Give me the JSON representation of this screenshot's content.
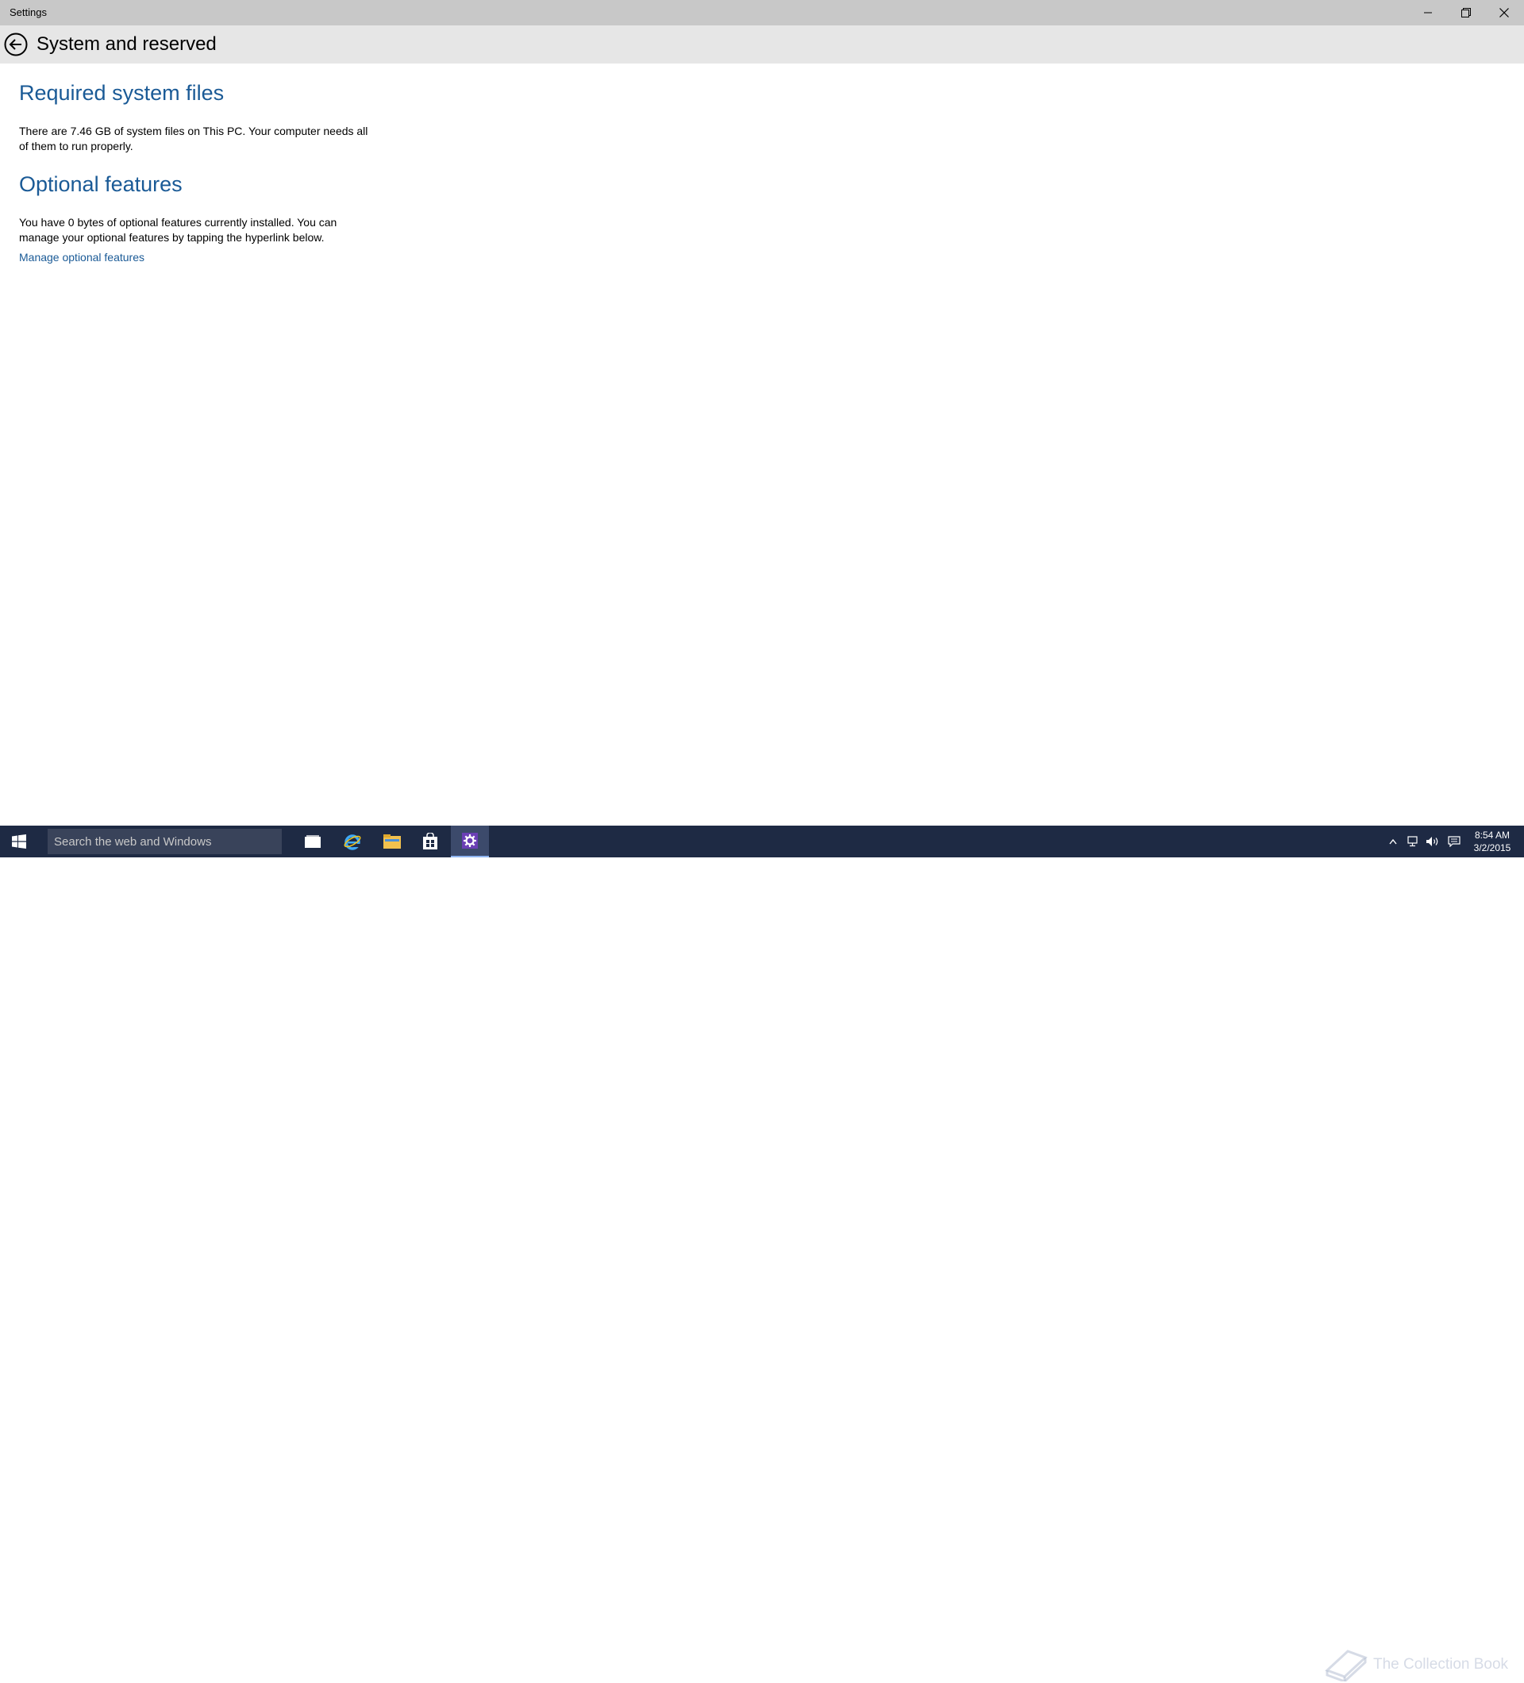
{
  "window": {
    "title": "Settings",
    "controls": [
      "minimize-icon",
      "restore-icon",
      "close-icon"
    ]
  },
  "header": {
    "back_icon": "back-arrow-icon",
    "page_title": "System and reserved"
  },
  "sections": {
    "required": {
      "title": "Required system files",
      "text": "There are 7.46 GB of system files on This PC. Your computer needs all of them to run properly."
    },
    "optional": {
      "title": "Optional features",
      "text": "You have 0 bytes of optional features currently installed. You can manage your optional features by tapping the hyperlink below.",
      "link": "Manage optional features"
    }
  },
  "taskbar": {
    "search_placeholder": "Search the web and Windows",
    "apps": [
      "task-view-icon",
      "internet-explorer-icon",
      "file-explorer-icon",
      "store-icon",
      "settings-icon"
    ],
    "active_app": "settings-icon",
    "tray_icons": [
      "chevron-up-icon",
      "network-icon",
      "volume-icon",
      "notifications-icon"
    ],
    "time": "8:54 AM",
    "date": "3/2/2015",
    "watermark": "The Collection Book"
  },
  "colors": {
    "accent": "#1a5a96",
    "titlebar": "#c8c8c8",
    "header": "#e6e6e6",
    "taskbar": "#1e2a44"
  }
}
